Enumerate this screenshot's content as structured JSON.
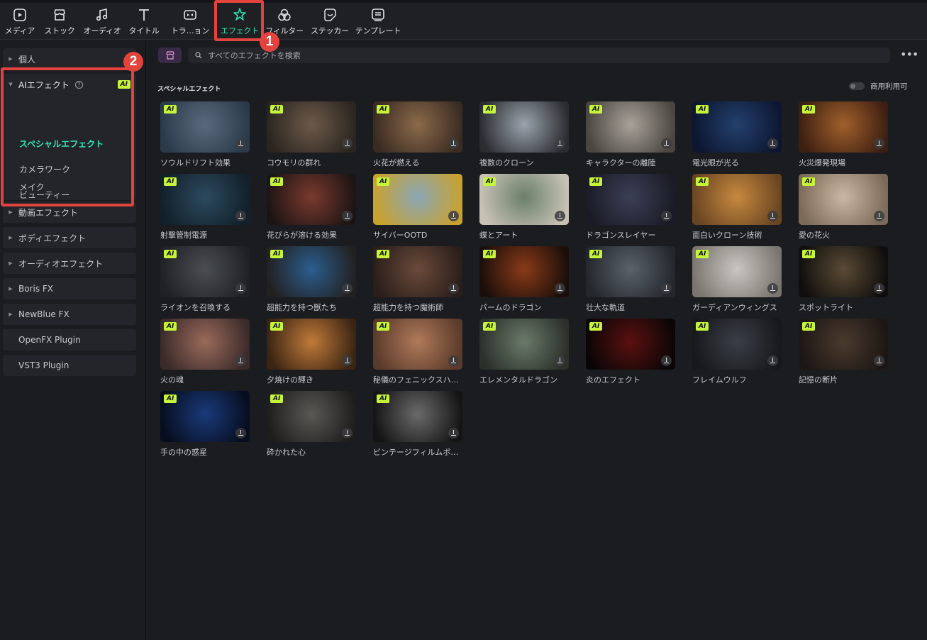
{
  "toolbar": {
    "tabs": [
      {
        "label": "メディア",
        "icon": "media-icon"
      },
      {
        "label": "ストック",
        "icon": "stock-icon"
      },
      {
        "label": "オーディオ",
        "icon": "audio-icon"
      },
      {
        "label": "タイトル",
        "icon": "title-icon"
      },
      {
        "label": "トラ…ョン",
        "icon": "transition-icon"
      },
      {
        "label": "エフェクト",
        "icon": "effects-icon",
        "active": true
      },
      {
        "label": "フィルター",
        "icon": "filter-icon"
      },
      {
        "label": "ステッカー",
        "icon": "sticker-icon"
      },
      {
        "label": "テンプレート",
        "icon": "template-icon"
      }
    ],
    "accent_color": "#2ee6b5"
  },
  "annotations": [
    {
      "number": "1",
      "color": "#e2433d"
    },
    {
      "number": "2",
      "color": "#e2433d"
    }
  ],
  "sidebar": {
    "personal": "個人",
    "ai_effects": {
      "label": "AIエフェクト",
      "help": "?",
      "badge": "AI",
      "children": [
        "スペシャルエフェクト",
        "カメラワーク",
        "ビューティー",
        "メイク"
      ],
      "active_child": "スペシャルエフェクト"
    },
    "groups": [
      "動画エフェクト",
      "ボディエフェクト",
      "オーディオエフェクト",
      "Boris FX",
      "NewBlue FX"
    ],
    "plugins": [
      "OpenFX Plugin",
      "VST3 Plugin"
    ]
  },
  "search": {
    "placeholder": "すべてのエフェクトを検索"
  },
  "more_menu": "•••",
  "section": {
    "title": "スペシャルエフェクト",
    "commercial_toggle_label": "商用利用可",
    "commercial_toggle_on": false
  },
  "ai_badge": "AI",
  "effects": [
    {
      "name": "ソウルドリフト効果",
      "bg": [
        "#5a6a7c",
        "#2b3a4b"
      ]
    },
    {
      "name": "コウモリの群れ",
      "bg": [
        "#6d5a49",
        "#2b2520"
      ]
    },
    {
      "name": "火花が燃える",
      "bg": [
        "#8b6a4a",
        "#3a2b22"
      ]
    },
    {
      "name": "複数のクローン",
      "bg": [
        "#9aa3ad",
        "#2a2c30"
      ]
    },
    {
      "name": "キャラクターの離陸",
      "bg": [
        "#a8a29a",
        "#4a4540"
      ]
    },
    {
      "name": "電光眼が光る",
      "bg": [
        "#23406e",
        "#0d1630"
      ]
    },
    {
      "name": "火災爆発現場",
      "bg": [
        "#a0602b",
        "#3d1f12"
      ]
    },
    {
      "name": "射撃管制電源",
      "bg": [
        "#2c4a5e",
        "#12202a"
      ]
    },
    {
      "name": "花びらが溶ける効果",
      "bg": [
        "#7a3a2e",
        "#1c1414"
      ]
    },
    {
      "name": "サイバーOOTD",
      "bg": [
        "#8aa7b8",
        "#c9a22e"
      ]
    },
    {
      "name": "蝶とアート",
      "bg": [
        "#6b7f6a",
        "#c8c2b6"
      ]
    },
    {
      "name": "ドラゴンスレイヤー",
      "bg": [
        "#3b3f55",
        "#1a1b26"
      ]
    },
    {
      "name": "面白いクローン技術",
      "bg": [
        "#c7893f",
        "#6a4522"
      ]
    },
    {
      "name": "愛の花火",
      "bg": [
        "#c9b8a4",
        "#7c6a58"
      ]
    },
    {
      "name": "ライオンを召喚する",
      "bg": [
        "#4a4d52",
        "#1f2125"
      ]
    },
    {
      "name": "超能力を持つ獣たち",
      "bg": [
        "#2a5e8e",
        "#232020"
      ]
    },
    {
      "name": "超能力を持つ魔術師",
      "bg": [
        "#6a4a3a",
        "#2a1e1a"
      ]
    },
    {
      "name": "パームのドラゴン",
      "bg": [
        "#8a3a18",
        "#1a0e0a"
      ]
    },
    {
      "name": "壮大な軌道",
      "bg": [
        "#5a626a",
        "#23272c"
      ]
    },
    {
      "name": "ガーディアンウィングス",
      "bg": [
        "#c9c6c2",
        "#7a756e"
      ]
    },
    {
      "name": "スポットライト",
      "bg": [
        "#5a4a34",
        "#0f0e0d"
      ]
    },
    {
      "name": "火の魂",
      "bg": [
        "#9a6a5a",
        "#3a2a2a"
      ]
    },
    {
      "name": "夕焼けの輝き",
      "bg": [
        "#c07a3a",
        "#3a2412"
      ]
    },
    {
      "name": "秘儀のフェニックスハ…",
      "bg": [
        "#b07a5a",
        "#5a3a2a"
      ]
    },
    {
      "name": "エレメンタルドラゴン",
      "bg": [
        "#6a7a6a",
        "#2a302a"
      ]
    },
    {
      "name": "炎のエフェクト",
      "bg": [
        "#5a1010",
        "#0a0606"
      ]
    },
    {
      "name": "フレイムウルフ",
      "bg": [
        "#3a3e46",
        "#17181c"
      ]
    },
    {
      "name": "記憶の断片",
      "bg": [
        "#4a3a2e",
        "#1c1614"
      ]
    },
    {
      "name": "手の中の惑星",
      "bg": [
        "#1a3a7a",
        "#070d1e"
      ]
    },
    {
      "name": "砕かれた心",
      "bg": [
        "#5a5854",
        "#1e1d1c"
      ]
    },
    {
      "name": "ビンテージフィルムボ…",
      "bg": [
        "#6a6a6a",
        "#141414"
      ]
    }
  ]
}
